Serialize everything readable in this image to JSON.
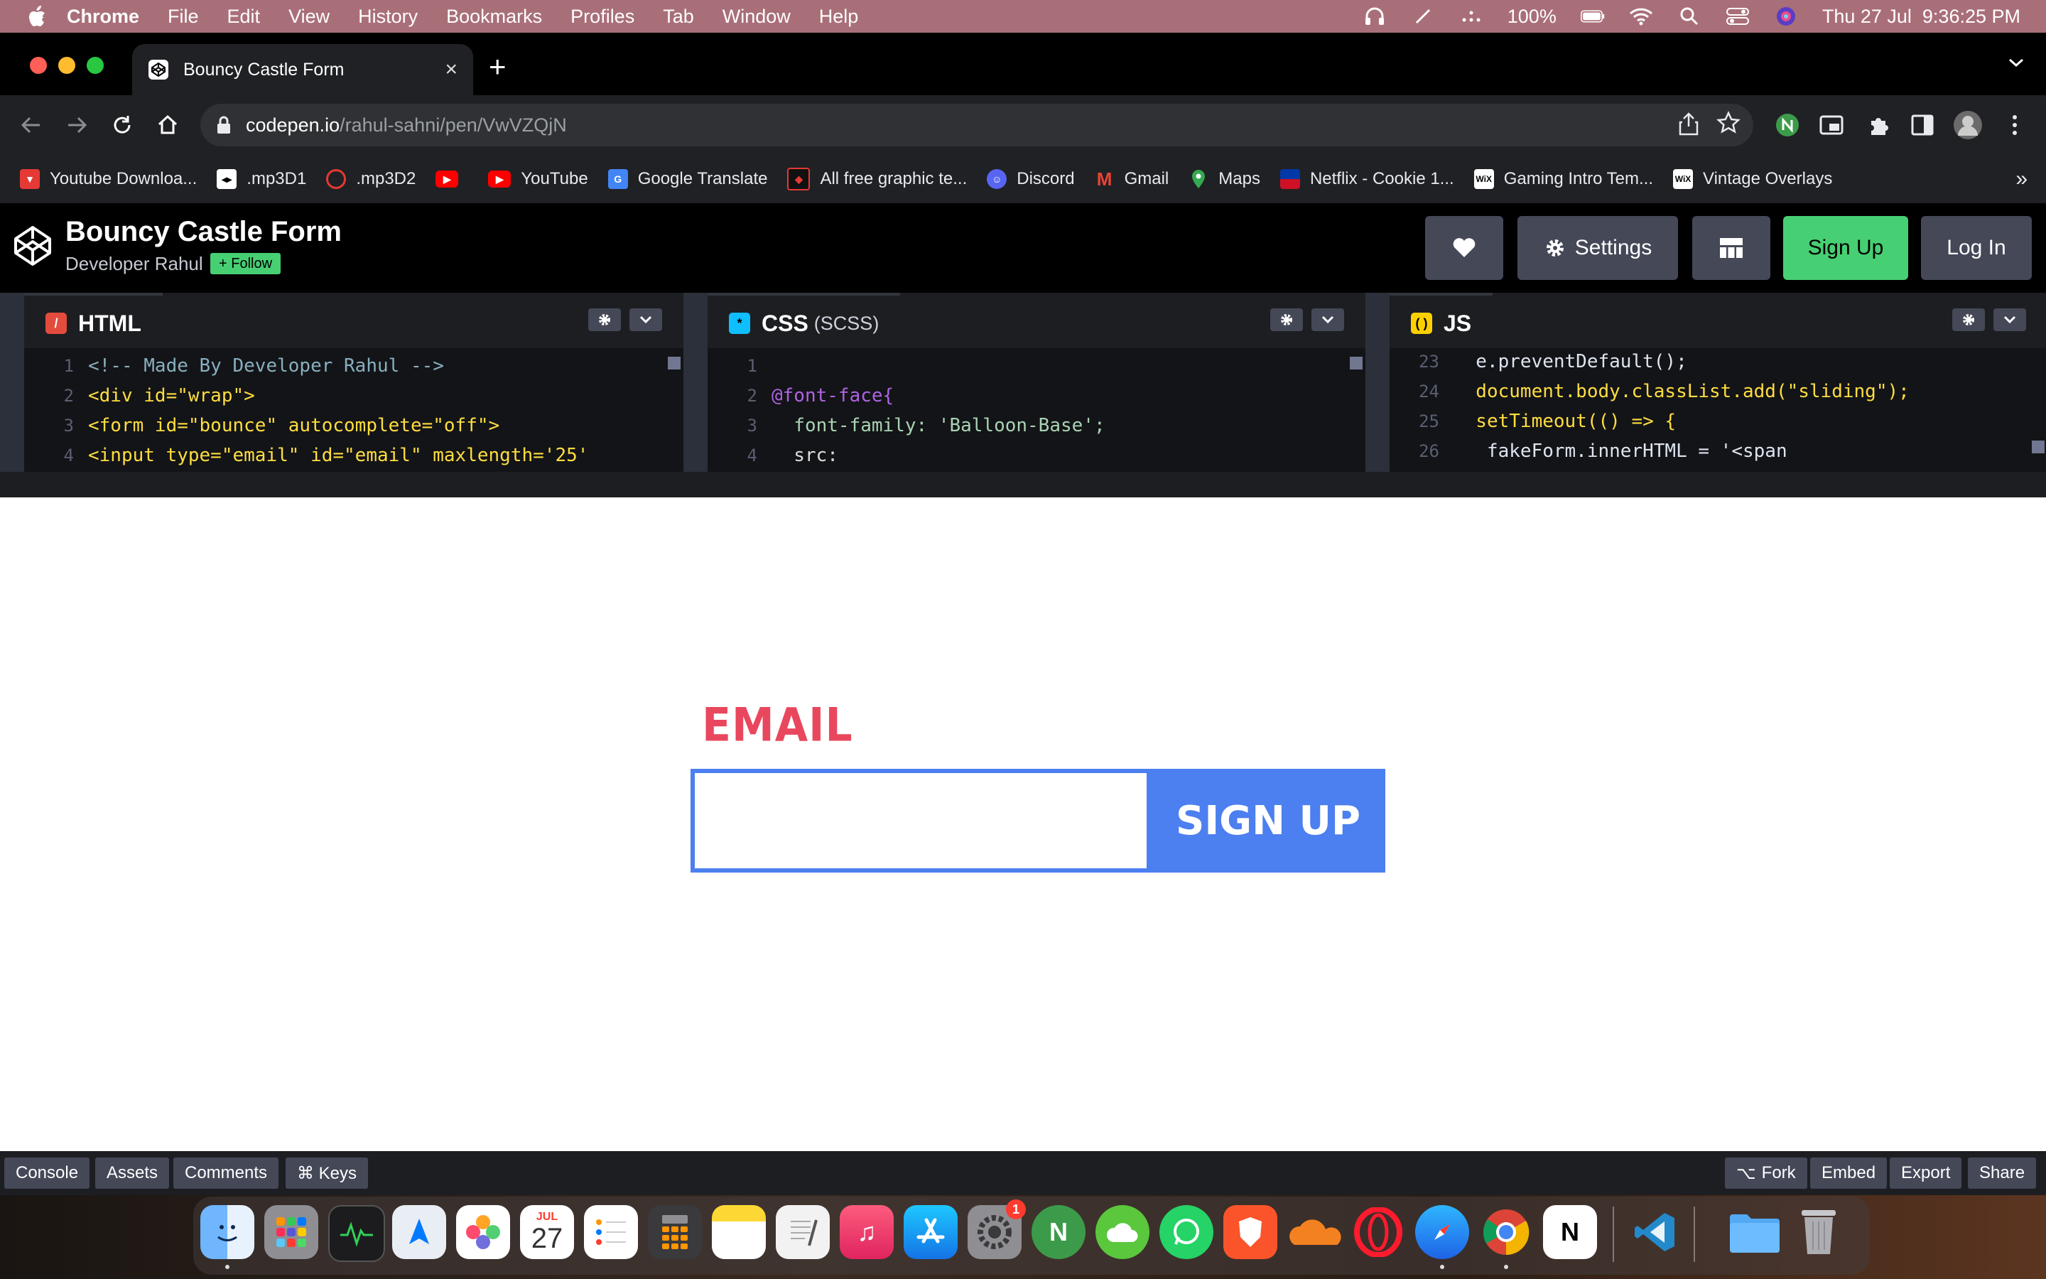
{
  "menubar": {
    "app": "Chrome",
    "items": [
      "File",
      "Edit",
      "View",
      "History",
      "Bookmarks",
      "Profiles",
      "Tab",
      "Window",
      "Help"
    ],
    "battery": "100%",
    "datetime": "Thu 27 Jul  9:36:25 PM"
  },
  "browser": {
    "tab_title": "Bouncy Castle Form",
    "url_host": "codepen.io",
    "url_path": "/rahul-sahni/pen/VwVZQjN"
  },
  "bookmarks": [
    {
      "label": "Youtube Downloa...",
      "icon": "youtube-downloader-icon",
      "color": "#e53935"
    },
    {
      "label": ".mp3D1",
      "icon": "mp3-icon",
      "color": "#ffffff"
    },
    {
      "label": ".mp3D2",
      "icon": "mp3-circle-icon",
      "color": "#e53935"
    },
    {
      "label": "",
      "icon": "youtube-icon",
      "color": "#ff0000"
    },
    {
      "label": "YouTube",
      "icon": "youtube-icon",
      "color": "#ff0000"
    },
    {
      "label": "Google Translate",
      "icon": "google-translate-icon",
      "color": "#4285f4"
    },
    {
      "label": "All free graphic te...",
      "icon": "graphic-icon",
      "color": "#e53935"
    },
    {
      "label": "Discord",
      "icon": "discord-icon",
      "color": "#5865f2"
    },
    {
      "label": "Gmail",
      "icon": "gmail-icon",
      "color": "#ea4335"
    },
    {
      "label": "Maps",
      "icon": "maps-icon",
      "color": "#34a853"
    },
    {
      "label": "Netflix - Cookie 1...",
      "icon": "netflix-flag-icon",
      "color": "#0038a8"
    },
    {
      "label": "Gaming Intro Tem...",
      "icon": "wix-icon",
      "color": "#ffffff"
    },
    {
      "label": "Vintage Overlays",
      "icon": "wix-icon",
      "color": "#ffffff"
    }
  ],
  "codepen": {
    "title": "Bouncy Castle Form",
    "author": "Developer Rahul",
    "follow": "+ Follow",
    "settings": "Settings",
    "signup": "Sign Up",
    "login": "Log In"
  },
  "editors": {
    "html": {
      "label": "HTML",
      "lines": [
        {
          "n": "1",
          "text": "<!-- Made By Developer Rahul -->"
        },
        {
          "n": "2",
          "text": "<div id=\"wrap\">"
        },
        {
          "n": "3",
          "text": "<form id=\"bounce\" autocomplete=\"off\">"
        },
        {
          "n": "4",
          "text": "<input type=\"email\" id=\"email\" maxlength='25'"
        }
      ]
    },
    "css": {
      "label": "CSS",
      "sublabel": "(SCSS)",
      "lines": [
        {
          "n": "1",
          "text": ""
        },
        {
          "n": "2",
          "text": "@font-face{"
        },
        {
          "n": "3",
          "text": "  font-family: 'Balloon-Base';"
        },
        {
          "n": "4",
          "text": "  src:"
        }
      ]
    },
    "js": {
      "label": "JS",
      "lines": [
        {
          "n": "23",
          "text": "  e.preventDefault();"
        },
        {
          "n": "24",
          "text": "  document.body.classList.add(\"sliding\");"
        },
        {
          "n": "25",
          "text": "  setTimeout(() => {"
        },
        {
          "n": "26",
          "text": "   fakeForm.innerHTML = '<span"
        }
      ]
    }
  },
  "preview": {
    "email_label": "EMAIL",
    "email_value": "",
    "signup_button": "SIGN UP",
    "colors": {
      "accent_blue": "#4c7fef",
      "label_red": "#e9475d"
    }
  },
  "footer": {
    "left": [
      "Console",
      "Assets",
      "Comments",
      "⌘ Keys"
    ],
    "right": [
      "Fork",
      "Embed",
      "Export",
      "Share"
    ]
  },
  "dock": {
    "calendar_month": "JUL",
    "calendar_day": "27",
    "settings_badge": "1"
  }
}
